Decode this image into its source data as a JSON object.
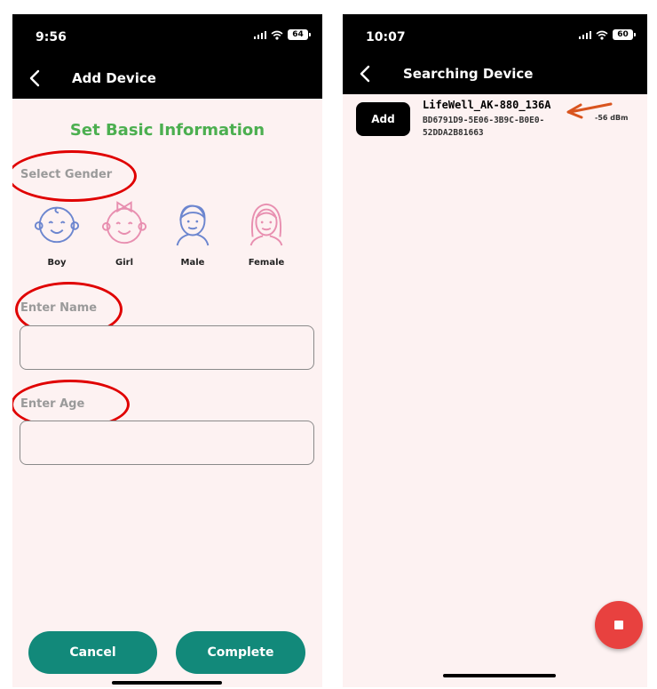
{
  "left_screen": {
    "status": {
      "time": "9:56",
      "battery": "64"
    },
    "nav": {
      "title": "Add Device"
    },
    "heading": "Set Basic Information",
    "gender": {
      "label": "Select Gender",
      "options": [
        {
          "label": "Boy",
          "icon": "boy-face-icon"
        },
        {
          "label": "Girl",
          "icon": "girl-face-icon"
        },
        {
          "label": "Male",
          "icon": "man-face-icon"
        },
        {
          "label": "Female",
          "icon": "woman-face-icon"
        }
      ]
    },
    "name_field": {
      "label": "Enter Name",
      "value": ""
    },
    "age_field": {
      "label": "Enter Age",
      "value": ""
    },
    "buttons": {
      "cancel": "Cancel",
      "complete": "Complete"
    },
    "colors": {
      "heading": "#4caf50",
      "button": "#12897a",
      "background": "#fdf2f2",
      "annotation": "#e00000"
    }
  },
  "right_screen": {
    "status": {
      "time": "10:07",
      "battery": "60"
    },
    "nav": {
      "title": "Searching Device"
    },
    "devices": [
      {
        "add_label": "Add",
        "name": "LifeWell_AK-880_136A",
        "uuid": "BD6791D9-5E06-3B9C-B0E0-52DDA2B81663",
        "rssi": "-56 dBm"
      }
    ],
    "fab": {
      "icon": "stop-icon",
      "color": "#e8413f"
    },
    "colors": {
      "annotation_arrow": "#d9541e"
    }
  }
}
